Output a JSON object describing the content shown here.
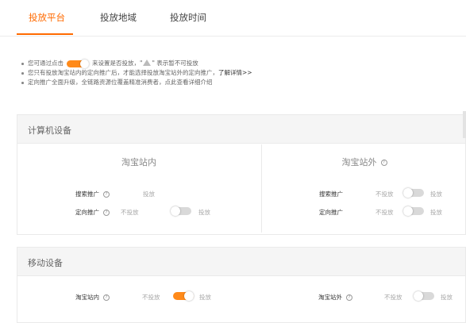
{
  "tabs": [
    {
      "label": "投放平台"
    },
    {
      "label": "投放地域"
    },
    {
      "label": "投放时间"
    }
  ],
  "notes": {
    "line1_a": "您可通过点击",
    "line1_b": "来设置是否投放，\"",
    "line1_c": "\" 表示暂不可投放",
    "line2_a": "您只有投放淘宝站内的定向推广后，才能选择投放淘宝站外的定向推广，",
    "line2_link": "了解详情>>",
    "line3": "定向推广全面升级，全链路资源位覆盖精准消费者，点此查看详细介绍"
  },
  "pc": {
    "title": "计算机设备",
    "inside": {
      "title": "淘宝站内",
      "search_label": "搜索推广",
      "search_state": "投放",
      "directed_label": "定向推广",
      "directed_off": "不投放",
      "directed_on": "投放"
    },
    "outside": {
      "title": "淘宝站外",
      "search_label": "搜索推广",
      "search_off": "不投放",
      "search_on": "投放",
      "directed_label": "定向推广",
      "directed_off": "不投放",
      "directed_on": "投放"
    }
  },
  "mobile": {
    "title": "移动设备",
    "inside_label": "淘宝站内",
    "inside_off": "不投放",
    "inside_on": "投放",
    "outside_label": "淘宝站外",
    "outside_off": "不投放",
    "outside_on": "投放"
  },
  "help_glyph": "?",
  "colors": {
    "accent": "#ff6a00",
    "toggle_on": "#ff8a1a",
    "toggle_off": "#d9d9d9"
  }
}
